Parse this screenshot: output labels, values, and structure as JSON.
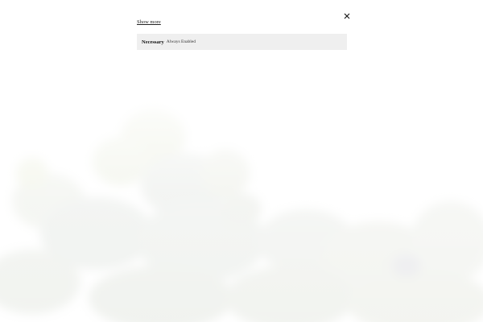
{
  "dialog": {
    "show_more_label": "Show more",
    "close_icon": "close-icon"
  },
  "consent_categories": [
    {
      "title": "Necessary",
      "status": "Always Enabled"
    }
  ],
  "colors": {
    "background": "#ffffff",
    "row_background": "#efefef",
    "text": "#111111",
    "foliage": "#d8dcc8"
  }
}
